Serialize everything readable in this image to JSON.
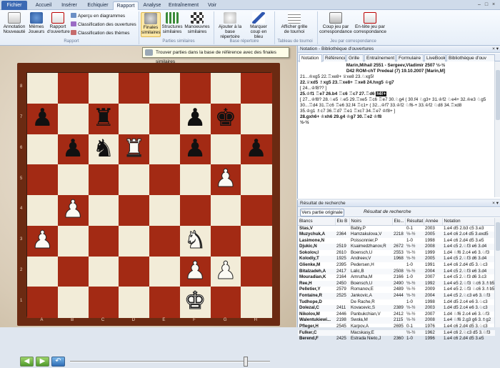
{
  "tabs": [
    "Fichier",
    "Accueil",
    "Insérer",
    "Echiquier",
    "Rapport",
    "Analyse",
    "Entraînement",
    "Voir"
  ],
  "window_controls": [
    "–",
    "□",
    "×"
  ],
  "ribbon": {
    "buttons": [
      {
        "label": "Annotation Nouveauté",
        "icon": "annotation-icon"
      },
      {
        "label": "Mêmes Joueurs",
        "icon": "players-icon"
      },
      {
        "label": "Rapport d'ouverture",
        "icon": "report-icon"
      },
      {
        "label": "Finales similaires",
        "icon": "similar-endgames-icon"
      },
      {
        "label": "Structures similaires",
        "icon": "structures-icon"
      },
      {
        "label": "Manoeuvres similaires",
        "icon": "maneuvers-icon"
      },
      {
        "label": "Ajouter à la base répertoire",
        "icon": "add-repertoire-icon"
      },
      {
        "label": "Marquer coup en bleu",
        "icon": "mark-blue-icon"
      },
      {
        "label": "Afficher grille de tournoi",
        "icon": "tournament-grid-icon"
      },
      {
        "label": "Coup jeu par correspondance",
        "icon": "correspondence-move-icon"
      },
      {
        "label": "En-tête jeu par correspondance",
        "icon": "correspondence-header-icon"
      }
    ],
    "small_buttons": [
      "Aperçu en diagrammes",
      "Classification des ouvertures",
      "Classification des thèmes"
    ],
    "groups": [
      "Rapport",
      "Parties similaires",
      "Base répertoire",
      "Tableau de tournoi",
      "Jeu par correspondance"
    ]
  },
  "tooltip": "Trouver parties dans la base de référence avec des finales similaires",
  "board": {
    "files": [
      "A",
      "B",
      "C",
      "D",
      "E",
      "F",
      "G",
      "H"
    ],
    "ranks": [
      "8",
      "7",
      "6",
      "5",
      "4",
      "3",
      "2",
      "1"
    ],
    "pieces": [
      {
        "sq": "a7",
        "glyph": "♟",
        "color": "b"
      },
      {
        "sq": "c7",
        "glyph": "♜",
        "color": "b"
      },
      {
        "sq": "f7",
        "glyph": "♟",
        "color": "b"
      },
      {
        "sq": "g7",
        "glyph": "♚",
        "color": "b"
      },
      {
        "sq": "b6",
        "glyph": "♟",
        "color": "b"
      },
      {
        "sq": "c6",
        "glyph": "♞",
        "color": "b"
      },
      {
        "sq": "d6",
        "glyph": "♜",
        "color": "w"
      },
      {
        "sq": "f6",
        "glyph": "♟",
        "color": "b"
      },
      {
        "sq": "h6",
        "glyph": "♟",
        "color": "b"
      },
      {
        "sq": "g5",
        "glyph": "♟",
        "color": "w"
      },
      {
        "sq": "b4",
        "glyph": "♟",
        "color": "w"
      },
      {
        "sq": "a3",
        "glyph": "♟",
        "color": "w"
      },
      {
        "sq": "f3",
        "glyph": "♞",
        "color": "w"
      },
      {
        "sq": "f2",
        "glyph": "♟",
        "color": "w"
      },
      {
        "sq": "g2",
        "glyph": "♟",
        "color": "w"
      },
      {
        "sq": "f1",
        "glyph": "♚",
        "color": "w"
      }
    ],
    "progress": 0.88
  },
  "nav": [
    "◀",
    "▶",
    "↶"
  ],
  "notation": {
    "title": "Notation - Bibliothèque d'ouvertures",
    "tabs": [
      "Notation",
      "Référence",
      "Grille",
      "Entraînement",
      "Formulaire",
      "LiveBook",
      "Bibliothèque d'ouv"
    ],
    "header1": "Marin,Mihail 2551 - Sergeev,Vladimir 2507 ½-½",
    "header2": "D42 ROM-chT Predeal (7) 19.10.2007 [Marin,M]",
    "lines": [
      "21...♔xg5 22.♖xe8+ ♕xe8 23.♘xg5!",
      "22.♕xd5 ♗xg5 23.♖xe8+ ♖xe8 24.hxg5 ♔g7",
      "[ 24...♔f8?? ]",
      "25.♔f1 ♖e7 26.b4 ♖c6 ♖c7 27.♖d6",
      "[ 27...♔f8? 28.♘e5 ♘e5 29.♖xe5 ♖c6 ♖e7 30.♘g4 ( 30.f4 ♘g3+ 31.♔f2 ♘e4+ 32.♔e3 ♘g5",
      "30...♖d4 31.♖c6 ♖e6 32.f4 ♖c1+ ( 32...♔f7 33.♔f2 ♘f6-+ 33.♔f2 ♘d8 34.♖xd8",
      "35.♔g1 ♗c7 36.♖d7 ♖e1 ♖xc7 34.♖e7 ♔f8+ ]",
      "28.gxh6+ ♔xh6 29.g4 ♔g7 30.♖e2 ♔f8",
      "½-½"
    ],
    "current_move": "h6!+"
  },
  "results": {
    "title": "Résultat de recherche",
    "button": "Vers partie originale",
    "label": "Résultat de recherche",
    "columns": [
      "Blancs",
      "Elo B",
      "Noirs",
      "Elo...",
      "Résultat",
      "Année",
      "Notation"
    ],
    "rows": [
      [
        "Stas,V",
        "",
        "Babiy,P",
        "",
        "0-1",
        "2003",
        "1.e4 d5 2.b3 c5 3.e3"
      ],
      [
        "Muzychuk,A",
        "2364",
        "Hamzakulova,V",
        "2218",
        "½-½",
        "2005",
        "1.e4 c6 2.c4 d5 3.exd5"
      ],
      [
        "Lasimone,N",
        "",
        "Poissonnier,P",
        "",
        "1-0",
        "1998",
        "1.e4 c6 2.d4 d5 3.e5"
      ],
      [
        "Djukic,N",
        "2519",
        "Ksaimedzhanov,R",
        "2672",
        "½-½",
        "2008",
        "1.e4 c5 2.♘f3 e6 3.d4"
      ],
      [
        "Sokolov,I",
        "2610",
        "Boensch,U",
        "2553",
        "½-½",
        "1999",
        "1.d4 ♘f6 2.c4 e6 3.♘f3"
      ],
      [
        "Kolodiy,T",
        "1925",
        "Andreev,V",
        "1968",
        "½-½",
        "2005",
        "1.e4 c5 2.♘f3 d6 3.d4"
      ],
      [
        "Glienke,M",
        "2395",
        "Pedersen,H",
        "",
        "1-0",
        "1991",
        "1.e4 c6 2.d4 d5 3.♘c3"
      ],
      [
        "Bitalzadeh,A",
        "2417",
        "Lalic,B",
        "2508",
        "½-½",
        "2004",
        "1.e4 c5 2.♘f3 e6 3.d4"
      ],
      [
        "Mouradian,K",
        "2164",
        "Amrutha,M",
        "2166",
        "1-0",
        "2007",
        "1.e4 c5 2.♘f3 d6 3.c3"
      ],
      [
        "Ree,H",
        "2450",
        "Boensch,U",
        "2490",
        "½-½",
        "1992",
        "1.e4 e5 2.♘f3 ♘c6 3.♗b5"
      ],
      [
        "Pelletier,Y",
        "2579",
        "Romanov,E",
        "2489",
        "½-½",
        "2009",
        "1.e4 e5 2.♘f3 ♘c6 3.♗b5"
      ],
      [
        "Fontaine,R",
        "2525",
        "Jankovic,A",
        "2444",
        "½-½",
        "2004",
        "1.e4 c5 2.♘c3 e6 3.♘f3"
      ],
      [
        "Tudhope,D",
        "",
        "De Rache,R",
        "",
        "1-0",
        "1998",
        "1.d4 d5 2.c4 e6 3.♘c3"
      ],
      [
        "Dolezal,C",
        "2411",
        "Kovacevic,S",
        "2389",
        "½-½",
        "2003",
        "1.d4 d5 2.c4 e6 3.♘c3"
      ],
      [
        "Nikolov,M",
        "2446",
        "Panbukchian,V",
        "2412",
        "½-½",
        "2007",
        "1.d4 ♘f6 2.c4 e6 3.♘f3"
      ],
      [
        "Walentukiewi...",
        "2198",
        "Swoła,M",
        "2115",
        "½-½",
        "2008",
        "1.e4 ♘f6 2.g3 g6 3.♗g2"
      ],
      [
        "Pfleger,H",
        "2545",
        "Karpov,A",
        "2695",
        "0-1",
        "1976",
        "1.e4 c6 2.d4 d5 3.♘c3"
      ],
      [
        "Fulker,C",
        "",
        "Macskasy,E",
        "",
        "½-½",
        "1962",
        "1.e4 c6 2.♘c3 d5 3.♘f3"
      ],
      [
        "Berend,F",
        "2425",
        "Estrada Nieto,J",
        "2360",
        "1-0",
        "1996",
        "1.e4 c6 2.d4 d5 3.e5"
      ]
    ]
  },
  "colors": {
    "dark_square": "#a32a14",
    "light_square": "#f2ecd8",
    "frame": "#6b2a12",
    "accent": "#3b69b3"
  }
}
